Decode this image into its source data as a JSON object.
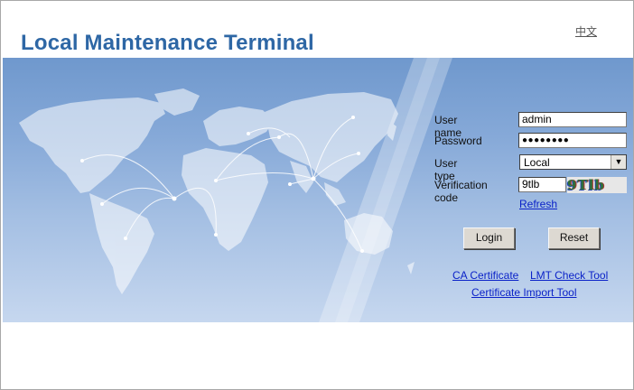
{
  "header": {
    "title": "Local Maintenance Terminal",
    "language_link": "中文"
  },
  "login_form": {
    "username_label": "User name",
    "username_value": "admin",
    "password_label": "Password",
    "password_value": "●●●●●●●●",
    "usertype_label": "User type",
    "usertype_selected": "Local",
    "verification_label": "Verification code",
    "verification_value": "9tlb",
    "captcha_text": "9Tlb",
    "refresh_link": "Refresh",
    "login_button": "Login",
    "reset_button": "Reset"
  },
  "footer_links": {
    "ca_certificate": "CA Certificate",
    "lmt_check_tool": "LMT Check Tool",
    "certificate_import_tool": "Certificate Import Tool"
  },
  "colors": {
    "title": "#2e67a5",
    "link": "#0b22c8",
    "banner_top": "#6f98cd",
    "banner_bottom": "#c6d7ef"
  }
}
